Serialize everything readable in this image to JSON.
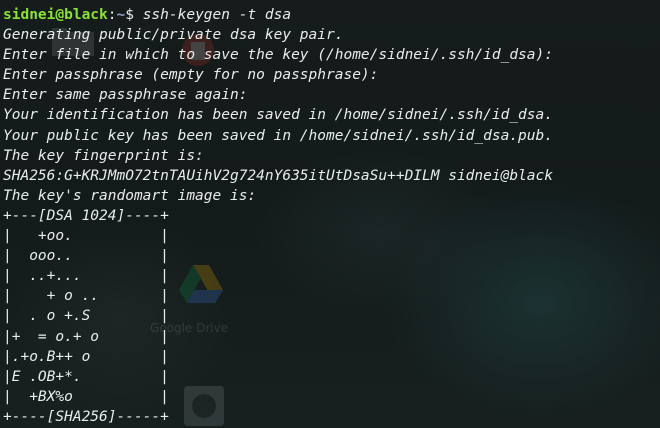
{
  "prompt": {
    "user_host": "sidnei@black",
    "path": "~",
    "symbol": "$",
    "command": " ssh-keygen -t dsa"
  },
  "output_lines": [
    "Generating public/private dsa key pair.",
    "Enter file in which to save the key (/home/sidnei/.ssh/id_dsa):",
    "Enter passphrase (empty for no passphrase):",
    "Enter same passphrase again:",
    "Your identification has been saved in /home/sidnei/.ssh/id_dsa.",
    "Your public key has been saved in /home/sidnei/.ssh/id_dsa.pub.",
    "The key fingerprint is:",
    "SHA256:G+KRJMmO72tnTAUihV2g724nY635itUtDsaSu++DILM sidnei@black",
    "The key's randomart image is:",
    "+---[DSA 1024]----+",
    "|   +oo.          |",
    "|  ooo..          |",
    "|  ..+...         |",
    "|    + o ..       |",
    "|  . o +.S        |",
    "|+  = o.+ o       |",
    "|.+o.B++ o        |",
    "|E .OB+*.         |",
    "|  +BX%o          |",
    "+----[SHA256]-----+"
  ],
  "desktop": {
    "labels": [
      "Google Drive"
    ],
    "icons": [
      "trash-icon",
      "google-drive-icon",
      "folder-icon",
      "app-icon"
    ]
  },
  "colors": {
    "prompt_user": "#8ae234",
    "prompt_path": "#8fa5c8",
    "text": "#e9ecec"
  }
}
